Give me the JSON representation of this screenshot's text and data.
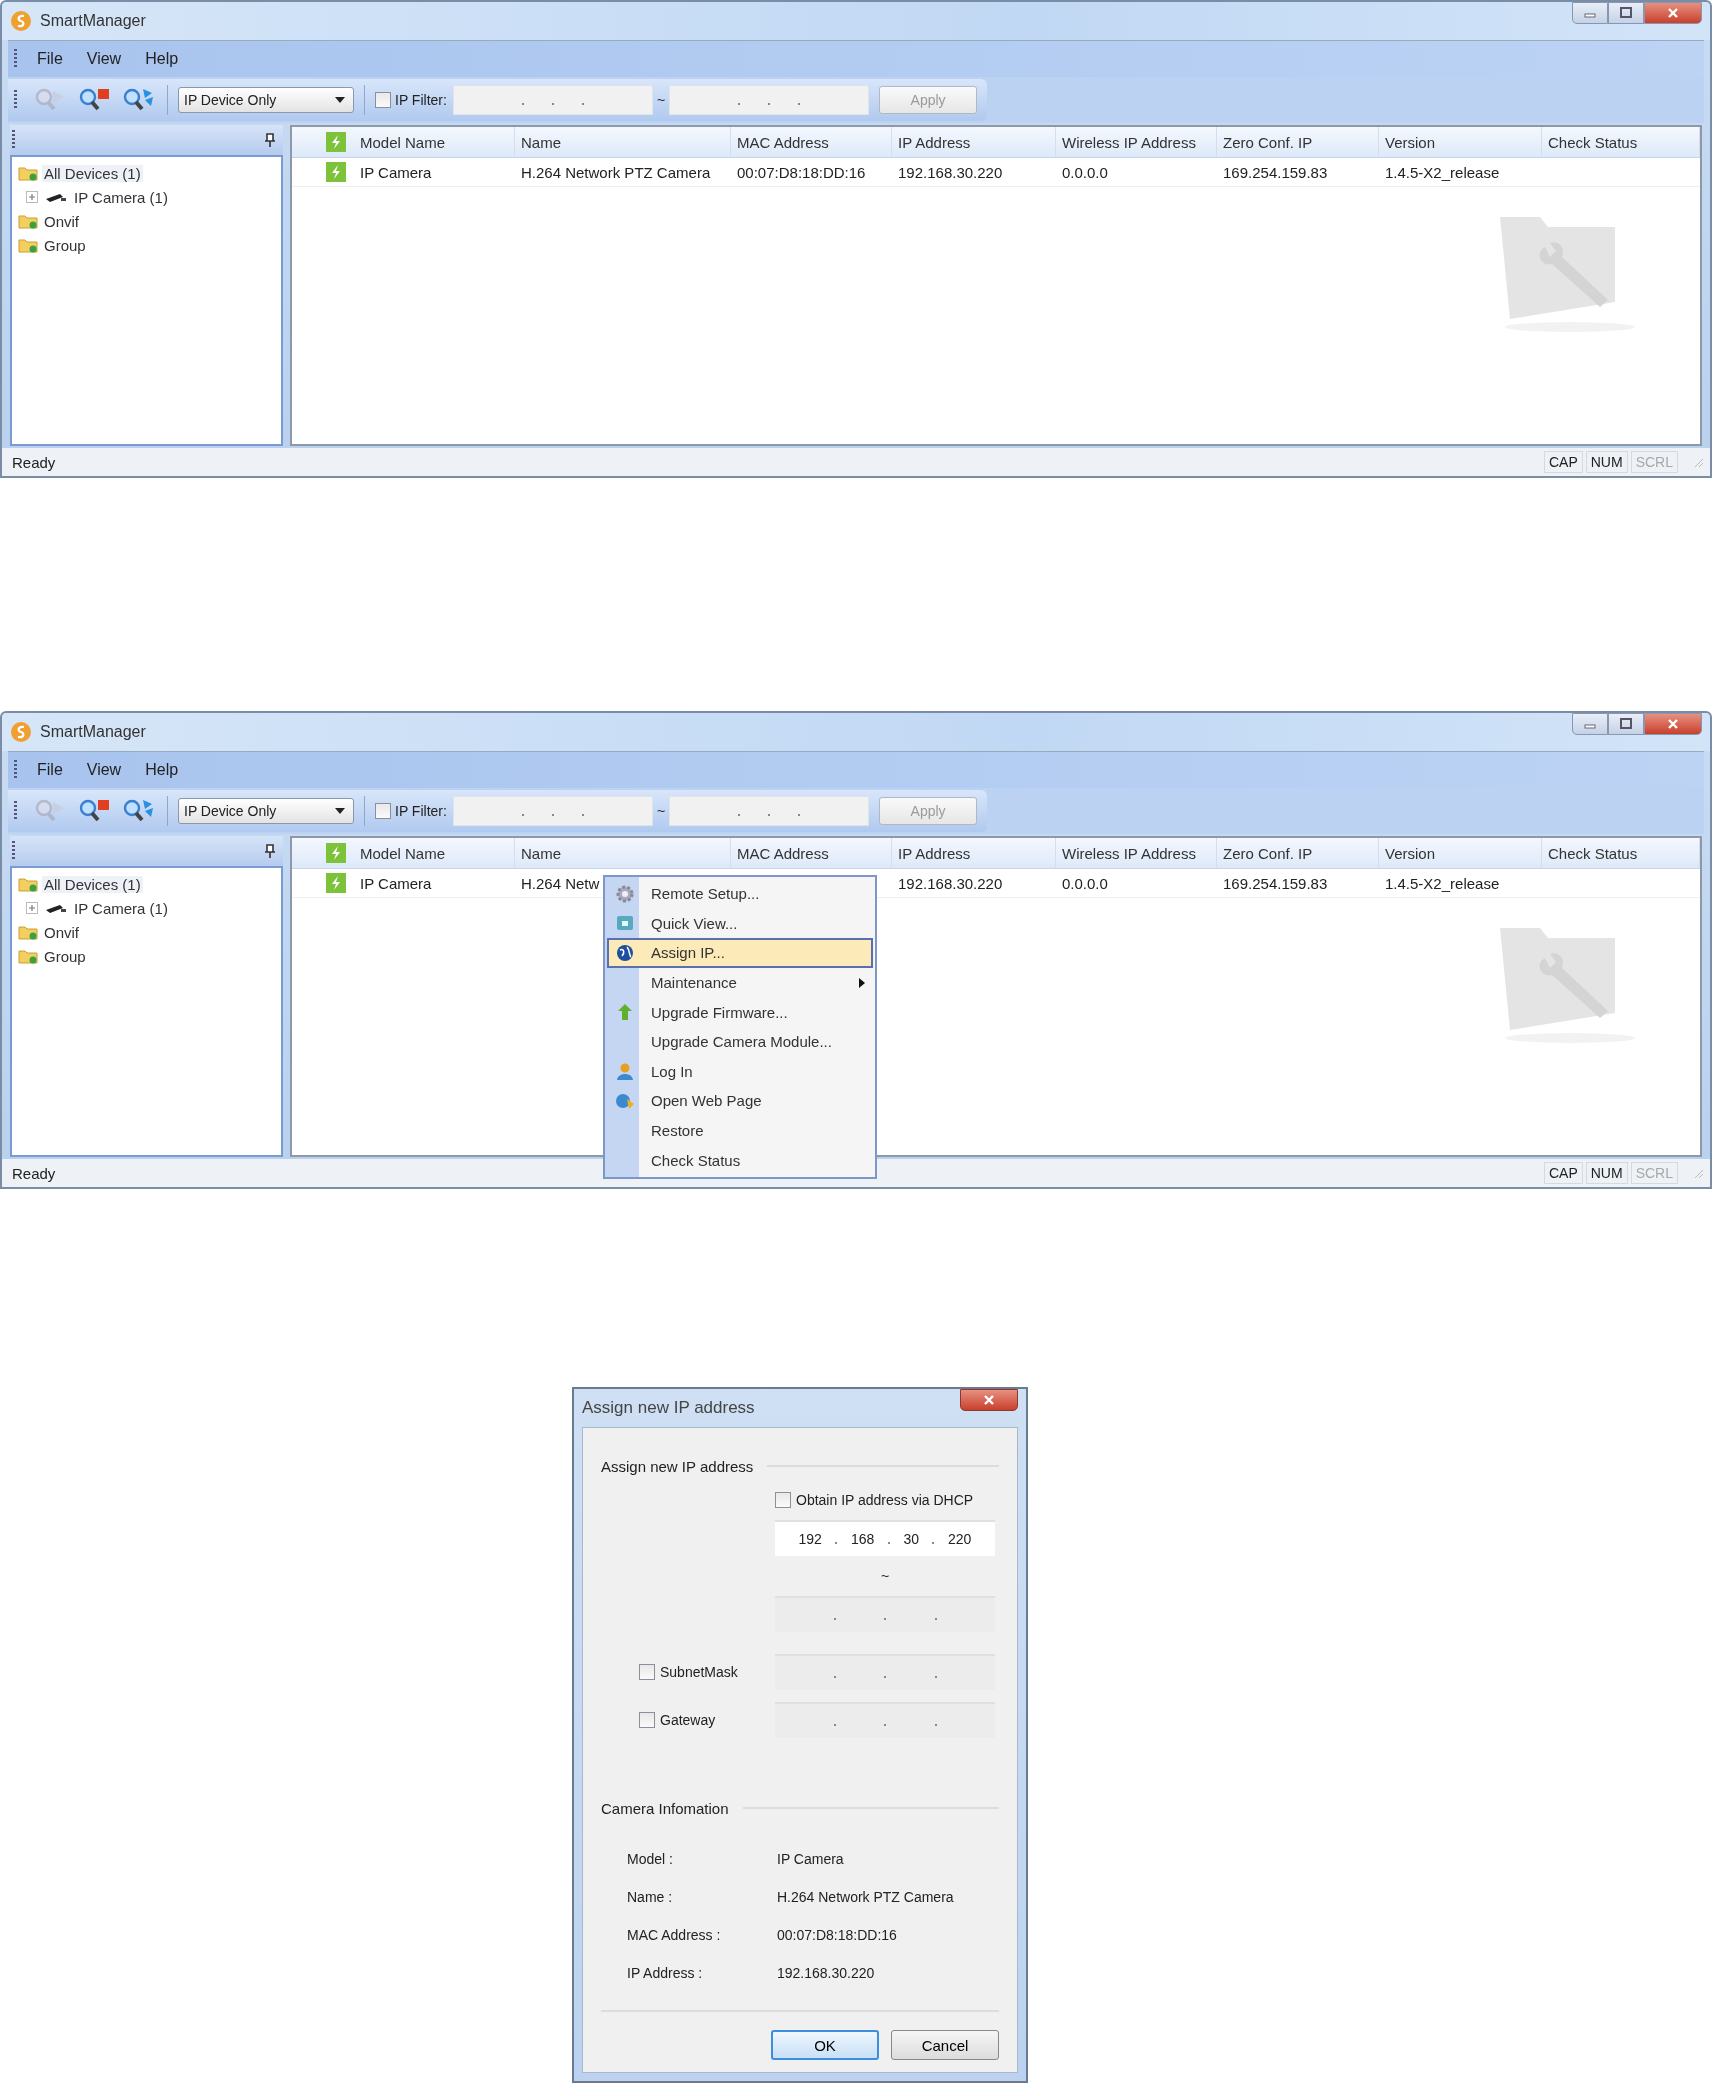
{
  "windows": [
    {
      "title": "SmartManager",
      "menu": [
        "File",
        "View",
        "Help"
      ],
      "tools": [
        {
          "kind": "play",
          "disabled": true
        },
        {
          "kind": "stop",
          "disabled": false
        },
        {
          "kind": "sync",
          "disabled": false
        }
      ],
      "device_filter": {
        "value": "IP Device Only"
      },
      "ip_filter": {
        "label": "IP Filter:",
        "checked": false,
        "range_sign": "~"
      },
      "apply": {
        "label": "Apply",
        "disabled": true
      },
      "tree": [
        {
          "label": "All Devices (1)",
          "kind": "folder",
          "selected": true,
          "children": [
            {
              "label": "IP Camera (1)",
              "kind": "camera",
              "selected": false,
              "expanded": false
            }
          ]
        },
        {
          "label": "Onvif",
          "kind": "folder",
          "selected": false
        },
        {
          "label": "Group",
          "kind": "folder",
          "selected": false
        }
      ],
      "table": {
        "columns": [
          "Model Name",
          "Name",
          "MAC Address",
          "IP Address",
          "Wireless IP Address",
          "Zero Conf. IP",
          "Version",
          "Check Status"
        ],
        "rows": [
          {
            "cells": [
              "IP Camera",
              "H.264 Network PTZ Camera",
              "00:07:D8:18:DD:16",
              "192.168.30.220",
              "0.0.0.0",
              "169.254.159.83",
              "1.4.5-X2_release"
            ]
          }
        ]
      },
      "status_bar": {
        "text": "Ready",
        "indicators": [
          {
            "label": "CAP",
            "on": true
          },
          {
            "label": "NUM",
            "on": true
          },
          {
            "label": "SCRL",
            "on": false
          }
        ]
      }
    },
    {
      "title": "SmartManager",
      "menu": [
        "File",
        "View",
        "Help"
      ],
      "tools": [
        {
          "kind": "play",
          "disabled": true
        },
        {
          "kind": "stop",
          "disabled": false
        },
        {
          "kind": "sync",
          "disabled": false
        }
      ],
      "device_filter": {
        "value": "IP Device Only"
      },
      "ip_filter": {
        "label": "IP Filter:",
        "checked": false,
        "range_sign": "~"
      },
      "apply": {
        "label": "Apply",
        "disabled": true
      },
      "tree": [
        {
          "label": "All Devices (1)",
          "kind": "folder",
          "selected": true,
          "children": [
            {
              "label": "IP Camera (1)",
              "kind": "camera",
              "selected": false,
              "expanded": false
            }
          ]
        },
        {
          "label": "Onvif",
          "kind": "folder",
          "selected": false
        },
        {
          "label": "Group",
          "kind": "folder",
          "selected": false
        }
      ],
      "table": {
        "columns": [
          "Model Name",
          "Name",
          "MAC Address",
          "IP Address",
          "Wireless IP Address",
          "Zero Conf. IP",
          "Version",
          "Check Status"
        ],
        "rows": [
          {
            "cells": [
              "IP Camera",
              "H.264 Netw",
              "",
              "192.168.30.220",
              "0.0.0.0",
              "169.254.159.83",
              "1.4.5-X2_release"
            ]
          }
        ]
      },
      "context_menu": {
        "items": [
          {
            "label": "Remote Setup...",
            "kind": "gear",
            "selected": false,
            "submenu": false
          },
          {
            "label": "Quick View...",
            "kind": "view",
            "selected": false,
            "submenu": false
          },
          {
            "label": "Assign IP...",
            "kind": "globe",
            "selected": true,
            "submenu": false
          },
          {
            "label": "Maintenance",
            "selected": false,
            "submenu": true
          },
          {
            "label": "Upgrade Firmware...",
            "kind": "arrow",
            "selected": false,
            "submenu": false
          },
          {
            "label": "Upgrade Camera Module...",
            "selected": false,
            "submenu": false
          },
          {
            "label": "Log In",
            "kind": "user",
            "selected": false,
            "submenu": false
          },
          {
            "label": "Open Web Page",
            "kind": "web",
            "selected": false,
            "submenu": false
          },
          {
            "label": "Restore",
            "selected": false,
            "submenu": false
          },
          {
            "label": "Check Status",
            "selected": false,
            "submenu": false
          }
        ]
      },
      "status_bar": {
        "text": "Ready",
        "indicators": [
          {
            "label": "CAP",
            "on": true
          },
          {
            "label": "NUM",
            "on": true
          },
          {
            "label": "SCRL",
            "on": false
          }
        ]
      }
    }
  ],
  "dialog": {
    "title": "Assign new IP address",
    "section": "Assign new IP address",
    "dhcp": {
      "label": "Obtain IP address via DHCP",
      "checked": false
    },
    "ip_from": [
      "192",
      "168",
      "30",
      "220"
    ],
    "range_sign": "~",
    "subnet": {
      "label": "SubnetMask",
      "checked": false
    },
    "gateway": {
      "label": "Gateway",
      "checked": false
    },
    "info_section": "Camera Infomation",
    "info": [
      {
        "label": "Model :",
        "value": "IP Camera"
      },
      {
        "label": "Name :",
        "value": "H.264 Network PTZ Camera"
      },
      {
        "label": "MAC Address :",
        "value": "00:07:D8:18:DD:16"
      },
      {
        "label": "IP Address :",
        "value": "192.168.30.220"
      }
    ],
    "buttons": [
      {
        "label": "OK",
        "selected": true
      },
      {
        "label": "Cancel",
        "selected": false
      }
    ]
  }
}
